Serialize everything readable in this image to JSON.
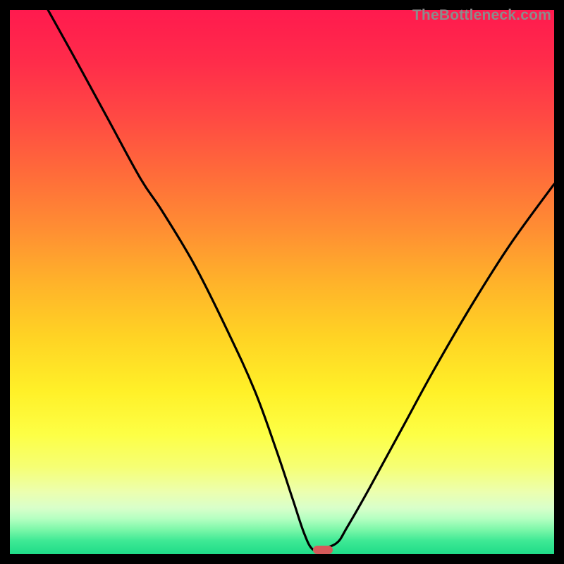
{
  "watermark": "TheBottleneck.com",
  "colors": {
    "frame": "#000000",
    "curve": "#000000",
    "pill": "#d65a5a",
    "gradient_stops": [
      {
        "offset": 0.0,
        "color": "#ff1a4e"
      },
      {
        "offset": 0.1,
        "color": "#ff2d4a"
      },
      {
        "offset": 0.2,
        "color": "#ff4a43"
      },
      {
        "offset": 0.3,
        "color": "#ff6b3a"
      },
      {
        "offset": 0.4,
        "color": "#ff8d33"
      },
      {
        "offset": 0.5,
        "color": "#ffb22a"
      },
      {
        "offset": 0.6,
        "color": "#ffd324"
      },
      {
        "offset": 0.7,
        "color": "#fff028"
      },
      {
        "offset": 0.78,
        "color": "#fdff45"
      },
      {
        "offset": 0.84,
        "color": "#f6ff74"
      },
      {
        "offset": 0.885,
        "color": "#ecffae"
      },
      {
        "offset": 0.915,
        "color": "#d9ffca"
      },
      {
        "offset": 0.935,
        "color": "#b4ffc1"
      },
      {
        "offset": 0.955,
        "color": "#7cf7a9"
      },
      {
        "offset": 0.975,
        "color": "#3fe995"
      },
      {
        "offset": 1.0,
        "color": "#1fdc88"
      }
    ]
  },
  "chart_data": {
    "type": "line",
    "title": "",
    "xlabel": "",
    "ylabel": "",
    "xlim": [
      0,
      100
    ],
    "ylim": [
      0,
      100
    ],
    "grid": false,
    "legend": false,
    "series": [
      {
        "name": "curve",
        "x": [
          7,
          12,
          18,
          24,
          28,
          34,
          40,
          45,
          49,
          52,
          54,
          55.5,
          57,
          60,
          62,
          66,
          72,
          78,
          85,
          92,
          100
        ],
        "y": [
          100,
          91,
          80,
          69,
          63,
          53,
          41,
          30,
          19,
          10,
          4,
          1,
          1,
          2,
          5,
          12,
          23,
          34,
          46,
          57,
          68
        ]
      }
    ],
    "marker": {
      "x": 57.5,
      "y": 0.8
    }
  }
}
